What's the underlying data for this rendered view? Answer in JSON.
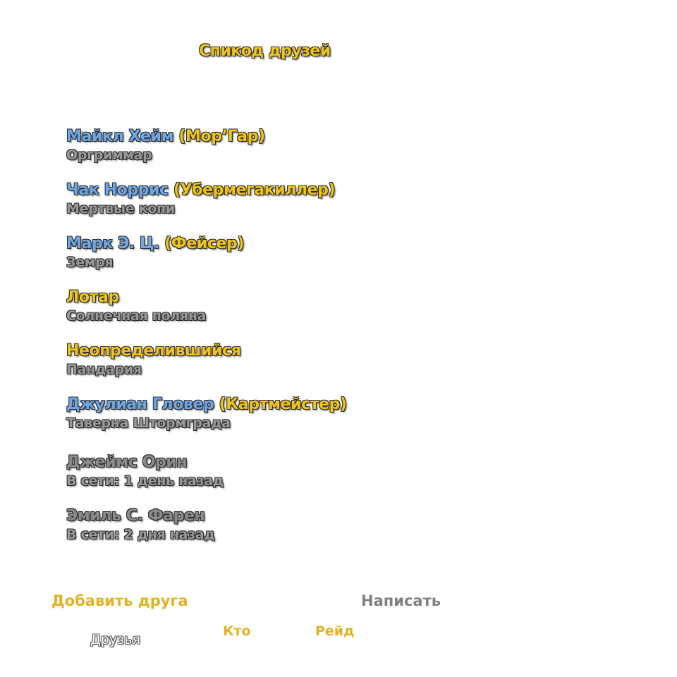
{
  "frame": {
    "title": "Спикод друзей"
  },
  "friends": [
    {
      "real_name": "Майкл Хейм",
      "char_name": " (Мор’Гар)",
      "location": "Оргриммар",
      "status": "online"
    },
    {
      "real_name": "Чак Норрис",
      "char_name": " (Убермегакиллер)",
      "location": "Мертвые копи",
      "status": "online"
    },
    {
      "real_name": "Марк Э. Ц.",
      "char_name": " (Фейсер)",
      "location": "Земря",
      "status": "online"
    },
    {
      "real_name": "",
      "char_name": "Лотар",
      "location": "Солнечная поляна",
      "status": "online"
    },
    {
      "real_name": "",
      "char_name": "Неопределившийся",
      "location": "Пандария",
      "status": "online"
    },
    {
      "real_name": "Джулиан Гловер",
      "char_name": " (Картмейстер)",
      "location": "Таверна Штормграда",
      "status": "online"
    },
    {
      "real_name": "",
      "char_name": "Джеймс Орин",
      "location": "В сети: 1 день назад",
      "status": "offline"
    },
    {
      "real_name": "",
      "char_name": "Эмиль С. Фарен",
      "location": "В сети: 2 дня назад",
      "status": "offline"
    }
  ],
  "buttons": {
    "add_friend": "Добавить друга",
    "send_message": "Написать"
  },
  "tabs": {
    "friends": "Друзья",
    "who": "Кто",
    "raid": "Рейд"
  },
  "colors": {
    "gold": "#f0c419",
    "battlenet_blue": "#6ea8e8",
    "offline_gray": "#8c8c8c"
  }
}
